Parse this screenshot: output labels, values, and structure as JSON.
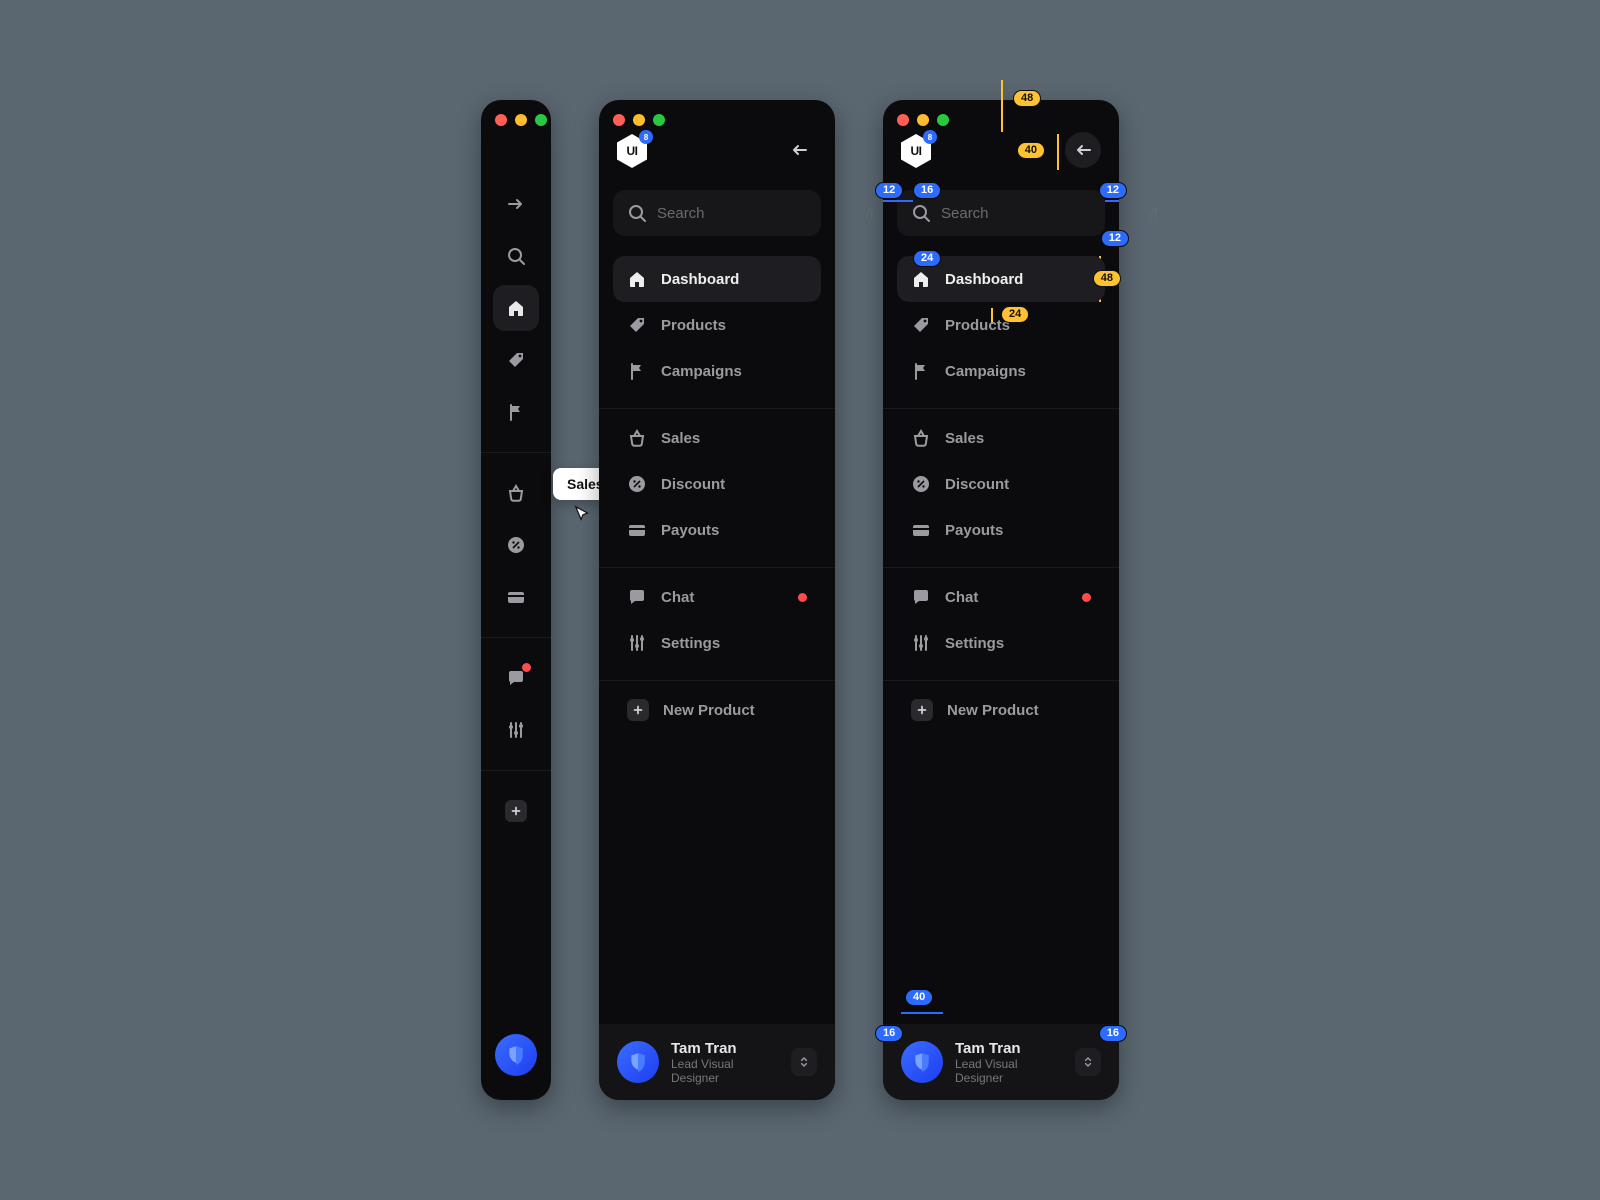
{
  "collapsed": {
    "tooltip": "Sales"
  },
  "logo": {
    "text": "UI",
    "badge": "8"
  },
  "search": {
    "placeholder": "Search",
    "shortcut": "/f"
  },
  "nav": {
    "group1": [
      {
        "id": "dashboard",
        "label": "Dashboard",
        "icon": "home",
        "active": true
      },
      {
        "id": "products",
        "label": "Products",
        "icon": "tag"
      },
      {
        "id": "campaigns",
        "label": "Campaigns",
        "icon": "flag"
      }
    ],
    "group2": [
      {
        "id": "sales",
        "label": "Sales",
        "icon": "basket"
      },
      {
        "id": "discount",
        "label": "Discount",
        "icon": "percent"
      },
      {
        "id": "payouts",
        "label": "Payouts",
        "icon": "card"
      }
    ],
    "group3": [
      {
        "id": "chat",
        "label": "Chat",
        "icon": "chat",
        "notif": true
      },
      {
        "id": "settings",
        "label": "Settings",
        "icon": "sliders"
      }
    ],
    "group4": [
      {
        "id": "new-product",
        "label": "New Product",
        "icon": "plus"
      }
    ]
  },
  "user": {
    "name": "Tam Tran",
    "role": "Lead Visual Designer"
  },
  "spec": {
    "top_gap": "48",
    "collapse_btn": "40",
    "outer_pad_left": "12",
    "inner_pad": "16",
    "outer_pad_right": "12",
    "row_pad": "24",
    "row_height": "48",
    "item_gap": "24",
    "search_gap": "12",
    "avatar": "40",
    "footer_pad": "16",
    "footer_pad_r": "16"
  }
}
